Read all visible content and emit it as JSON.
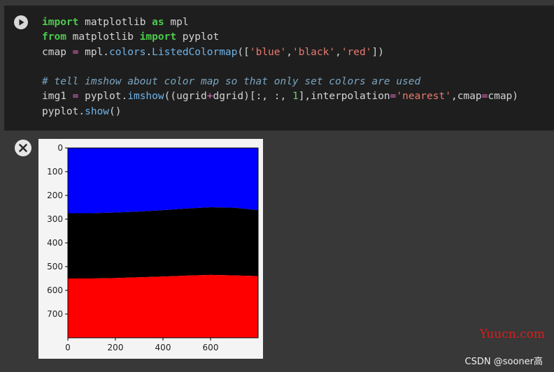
{
  "code_cell": {
    "lines": [
      [
        {
          "t": "import",
          "c": "kw"
        },
        {
          "t": " matplotlib "
        },
        {
          "t": "as",
          "c": "kw"
        },
        {
          "t": " mpl"
        }
      ],
      [
        {
          "t": "from",
          "c": "kw"
        },
        {
          "t": " matplotlib "
        },
        {
          "t": "import",
          "c": "kw"
        },
        {
          "t": " pyplot"
        }
      ],
      [
        {
          "t": "cmap "
        },
        {
          "t": "=",
          "c": "op"
        },
        {
          "t": " mpl."
        },
        {
          "t": "colors",
          "c": "attr"
        },
        {
          "t": "."
        },
        {
          "t": "ListedColormap",
          "c": "attr"
        },
        {
          "t": "(["
        },
        {
          "t": "'blue'",
          "c": "str"
        },
        {
          "t": ","
        },
        {
          "t": "'black'",
          "c": "str"
        },
        {
          "t": ","
        },
        {
          "t": "'red'",
          "c": "str"
        },
        {
          "t": "])"
        }
      ],
      [],
      [
        {
          "t": "# tell imshow about color map so that only set colors are used",
          "c": "cm"
        }
      ],
      [
        {
          "t": "img1 "
        },
        {
          "t": "=",
          "c": "op"
        },
        {
          "t": " pyplot."
        },
        {
          "t": "imshow",
          "c": "attr"
        },
        {
          "t": "((ugrid"
        },
        {
          "t": "+",
          "c": "op"
        },
        {
          "t": "dgrid)[:, :, "
        },
        {
          "t": "1",
          "c": "num"
        },
        {
          "t": "],interpolation"
        },
        {
          "t": "=",
          "c": "op"
        },
        {
          "t": "'nearest'",
          "c": "str"
        },
        {
          "t": ",cmap"
        },
        {
          "t": "=",
          "c": "op"
        },
        {
          "t": "cmap)"
        }
      ],
      [
        {
          "t": "pyplot."
        },
        {
          "t": "show",
          "c": "attr"
        },
        {
          "t": "()"
        }
      ]
    ],
    "run_icon": "play-icon"
  },
  "output": {
    "clear_icon": "close-icon"
  },
  "chart_data": {
    "type": "heatmap",
    "title": "",
    "xlabel": "",
    "ylabel": "",
    "xlim": [
      0,
      800
    ],
    "ylim": [
      800,
      0
    ],
    "x_ticks": [
      0,
      200,
      400,
      600
    ],
    "y_ticks": [
      0,
      100,
      200,
      300,
      400,
      500,
      600,
      700
    ],
    "colormap": [
      "#0000ff",
      "#000000",
      "#ff0000"
    ],
    "regions": [
      {
        "color": "#0000ff",
        "label": "blue",
        "upper_y": [
          [
            0,
            0
          ],
          [
            800,
            0
          ]
        ],
        "lower_y": [
          [
            0,
            275
          ],
          [
            100,
            275
          ],
          [
            200,
            272
          ],
          [
            300,
            268
          ],
          [
            400,
            262
          ],
          [
            500,
            255
          ],
          [
            600,
            250
          ],
          [
            700,
            252
          ],
          [
            800,
            262
          ]
        ]
      },
      {
        "color": "#000000",
        "label": "black",
        "upper_y": [
          [
            0,
            275
          ],
          [
            100,
            275
          ],
          [
            200,
            272
          ],
          [
            300,
            268
          ],
          [
            400,
            262
          ],
          [
            500,
            255
          ],
          [
            600,
            250
          ],
          [
            700,
            252
          ],
          [
            800,
            262
          ]
        ],
        "lower_y": [
          [
            0,
            550
          ],
          [
            100,
            550
          ],
          [
            200,
            548
          ],
          [
            300,
            545
          ],
          [
            400,
            542
          ],
          [
            500,
            538
          ],
          [
            600,
            535
          ],
          [
            700,
            537
          ],
          [
            800,
            540
          ]
        ]
      },
      {
        "color": "#ff0000",
        "label": "red",
        "upper_y": [
          [
            0,
            550
          ],
          [
            100,
            550
          ],
          [
            200,
            548
          ],
          [
            300,
            545
          ],
          [
            400,
            542
          ],
          [
            500,
            538
          ],
          [
            600,
            535
          ],
          [
            700,
            537
          ],
          [
            800,
            540
          ]
        ],
        "lower_y": [
          [
            0,
            800
          ],
          [
            800,
            800
          ]
        ]
      }
    ]
  },
  "watermarks": {
    "yuucn": "Yuucn.com",
    "csdn": "CSDN @sooner高"
  }
}
